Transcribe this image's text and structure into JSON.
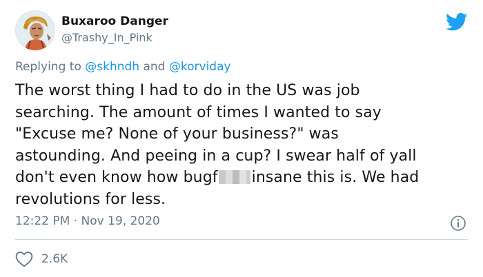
{
  "tweet": {
    "author_name": "Buxaroo Danger",
    "author_handle": "@Trashy_In_Pink",
    "reply": {
      "prefix": "Replying to",
      "mention_1": "@skhndh",
      "joiner": "and",
      "mention_2": "@korviday"
    },
    "body_lines": [
      "The worst thing I had to do in the US was job",
      "searching. The amount of times I wanted to say",
      "\"Excuse me? None of your business?\" was",
      "astounding. And peeing in a cup? I swear half of yall",
      "don't even know how bugf",
      "insane this is. We had",
      "revolutions for less."
    ],
    "time": "12:22 PM",
    "separator": "·",
    "date": "Nov 19, 2020",
    "likes": "2.6K"
  },
  "colors": {
    "text": "#14171a",
    "secondary": "#657786",
    "link": "#1b95e0",
    "divider": "#ccd6dd",
    "twitter_blue": "#1da1f2"
  },
  "icons": {
    "logo": "twitter-bird-icon",
    "info": "info-icon",
    "like": "heart-icon"
  }
}
